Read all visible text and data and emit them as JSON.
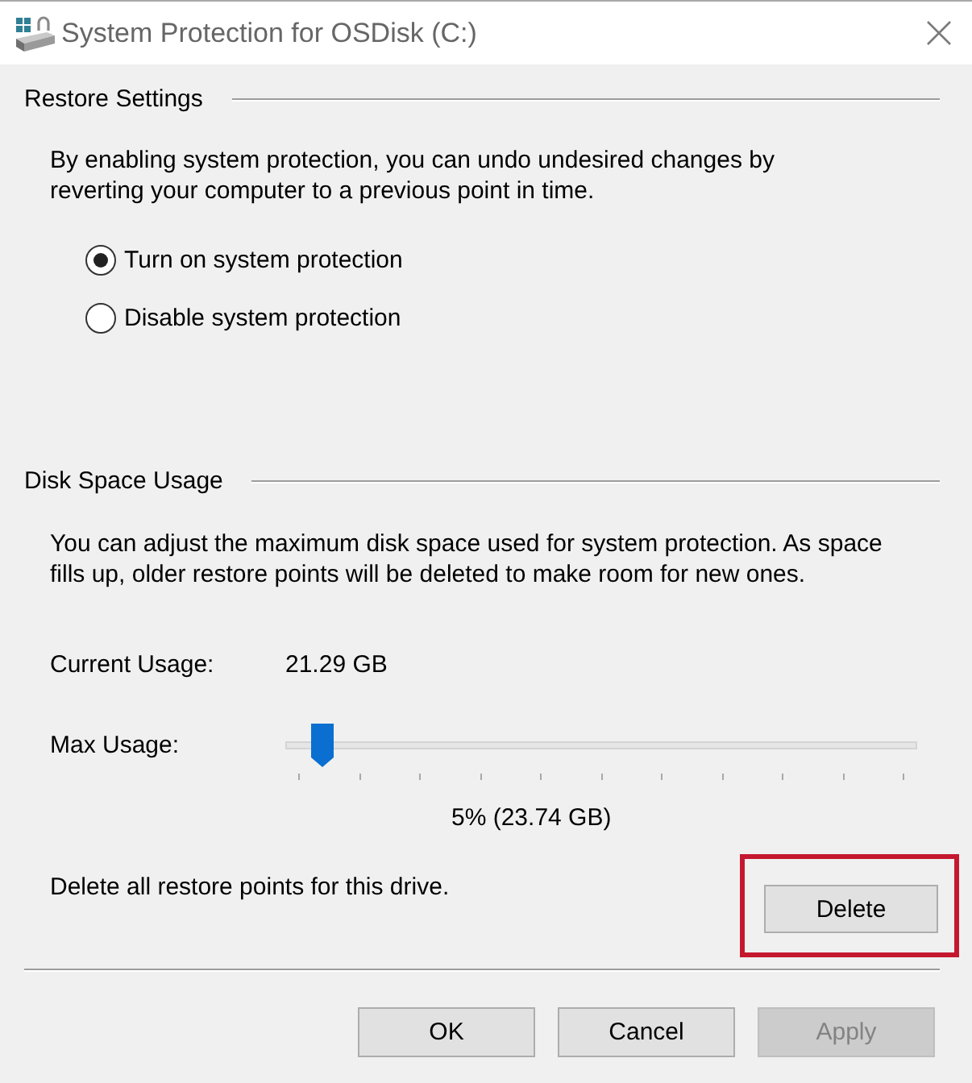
{
  "window": {
    "title": "System Protection for OSDisk (C:)"
  },
  "restore_settings": {
    "heading": "Restore Settings",
    "description": "By enabling system protection, you can undo undesired changes by reverting your computer to a previous point in time.",
    "options": [
      {
        "label": "Turn on system protection",
        "selected": true
      },
      {
        "label": "Disable system protection",
        "selected": false
      }
    ]
  },
  "disk_space_usage": {
    "heading": "Disk Space Usage",
    "description": "You can adjust the maximum disk space used for system protection. As space fills up, older restore points will be deleted to make room for new ones.",
    "current_usage": {
      "label": "Current Usage:",
      "value": "21.29 GB"
    },
    "max_usage": {
      "label": "Max Usage:",
      "level": 0.04,
      "reading": "5% (23.74 GB)"
    },
    "delete": {
      "label": "Delete all restore points for this drive.",
      "button": "Delete",
      "highlighted": true
    }
  },
  "buttons": [
    {
      "label": "OK",
      "disabled": false
    },
    {
      "label": "Cancel",
      "disabled": false
    },
    {
      "label": "Apply",
      "disabled": true
    }
  ]
}
